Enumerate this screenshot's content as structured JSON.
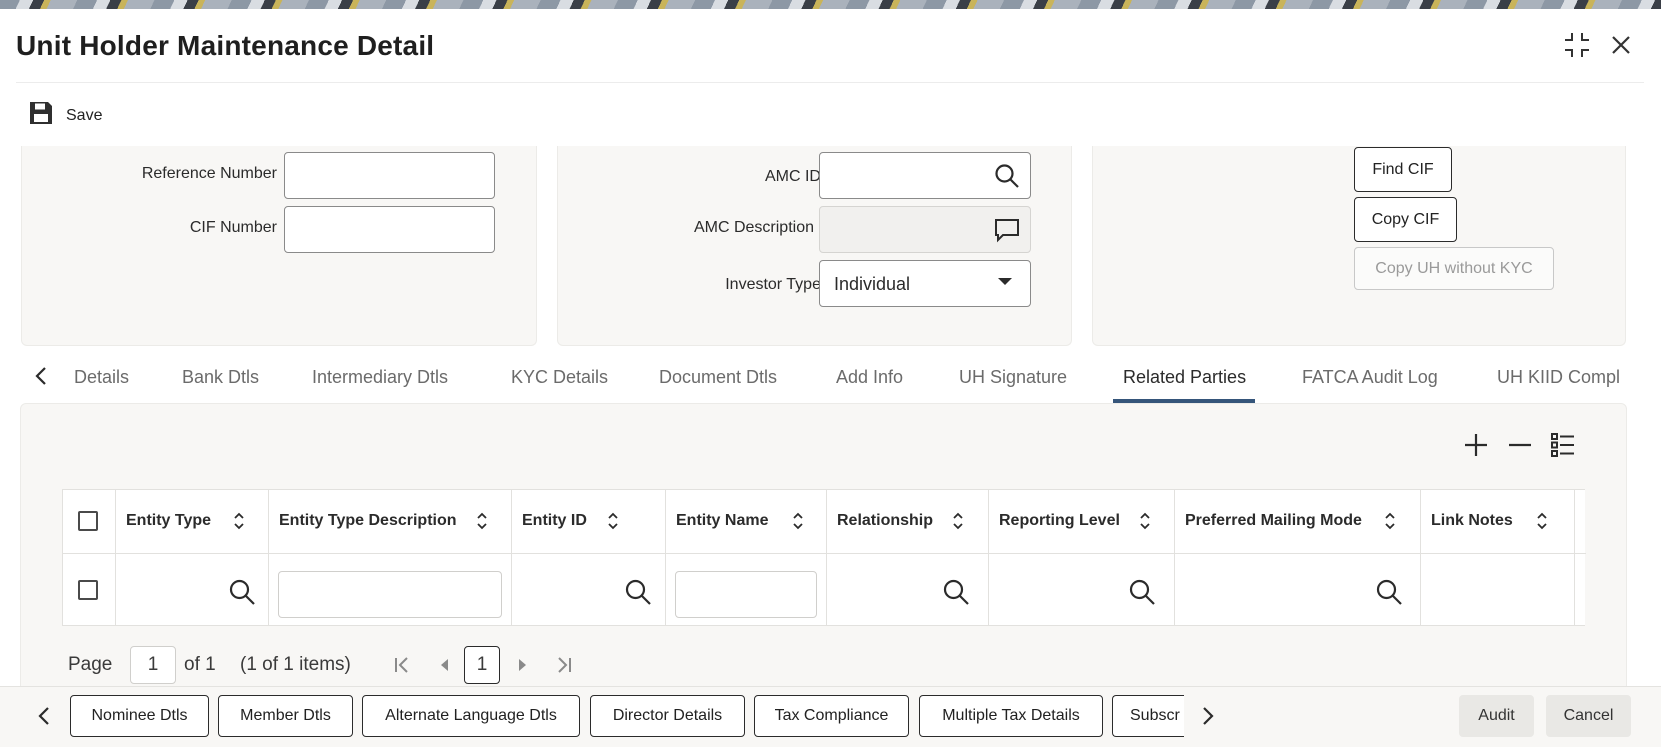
{
  "window": {
    "title": "Unit Holder Maintenance Detail",
    "icons": [
      "collapse-icon",
      "close-icon"
    ]
  },
  "toolbar": {
    "save_label": "Save"
  },
  "form": {
    "reference_number": {
      "label": "Reference Number",
      "value": ""
    },
    "cif_number": {
      "label": "CIF Number",
      "value": ""
    },
    "amc_id": {
      "label": "AMC ID",
      "required_mark": "*",
      "value": ""
    },
    "amc_description": {
      "label": "AMC Description",
      "value": ""
    },
    "investor_type": {
      "label": "Investor Type",
      "required_mark": "*",
      "value": "Individual"
    },
    "buttons": {
      "find_cif": "Find CIF",
      "copy_cif": "Copy CIF",
      "copy_uh_without_kyc": "Copy UH without KYC"
    }
  },
  "tabs": {
    "items": [
      "Details",
      "Bank Dtls",
      "Intermediary Dtls",
      "KYC Details",
      "Document Dtls",
      "Add Info",
      "UH Signature",
      "Related Parties",
      "FATCA Audit Log",
      "UH KIID Compl"
    ],
    "active": "Related Parties"
  },
  "grid": {
    "columns": [
      "Entity Type",
      "Entity Type Description",
      "Entity ID",
      "Entity Name",
      "Relationship",
      "Reporting Level",
      "Preferred Mailing Mode",
      "Link Notes"
    ],
    "rows": [
      {
        "entity_type": "",
        "entity_type_description": "",
        "entity_id": "",
        "entity_name": "",
        "relationship": "",
        "reporting_level": "",
        "preferred_mailing_mode": "",
        "link_notes": ""
      }
    ]
  },
  "pager": {
    "page_label": "Page",
    "page_value": "1",
    "of_label": "of 1",
    "items_label": "(1 of 1 items)",
    "current_page": "1"
  },
  "footer": {
    "buttons": [
      "Nominee Dtls",
      "Member Dtls",
      "Alternate Language Dtls",
      "Director Details",
      "Tax Compliance",
      "Multiple Tax Details",
      "Subscr"
    ],
    "audit_label": "Audit",
    "cancel_label": "Cancel"
  },
  "colors": {
    "accent_underline": "#35557a",
    "required": "#c74634",
    "panel_bg": "#f8f7f5"
  }
}
